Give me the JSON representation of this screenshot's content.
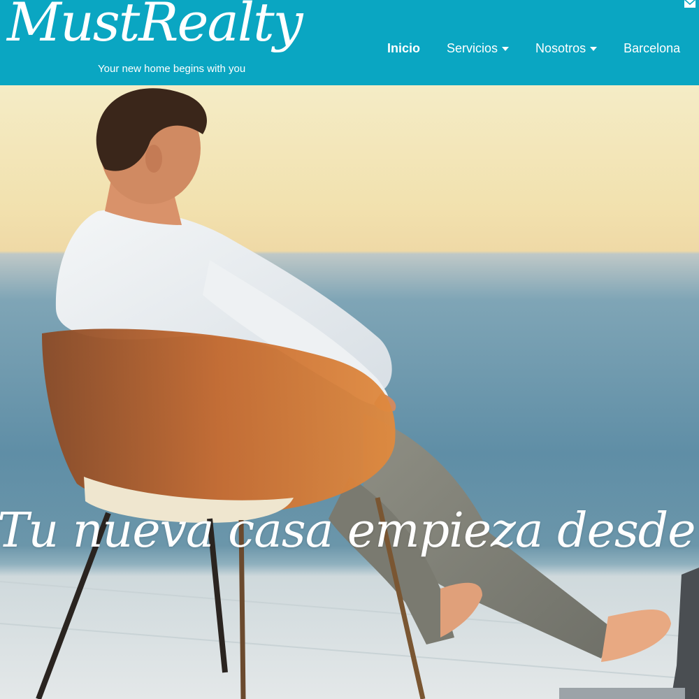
{
  "brand": {
    "name": "MustRealty",
    "tagline": "Your new home begins with you"
  },
  "nav": {
    "items": [
      {
        "label": "Inicio",
        "active": true,
        "dropdown": false
      },
      {
        "label": "Servicios",
        "active": false,
        "dropdown": true
      },
      {
        "label": "Nosotros",
        "active": false,
        "dropdown": true
      },
      {
        "label": "Barcelona",
        "active": false,
        "dropdown": false
      }
    ]
  },
  "hero": {
    "slogan": "Tu nueva casa empieza desde ti"
  },
  "icons": {
    "mail": "envelope-icon",
    "caret": "chevron-down-icon"
  },
  "colors": {
    "header_bg": "#0aa6c2",
    "text": "#ffffff"
  }
}
